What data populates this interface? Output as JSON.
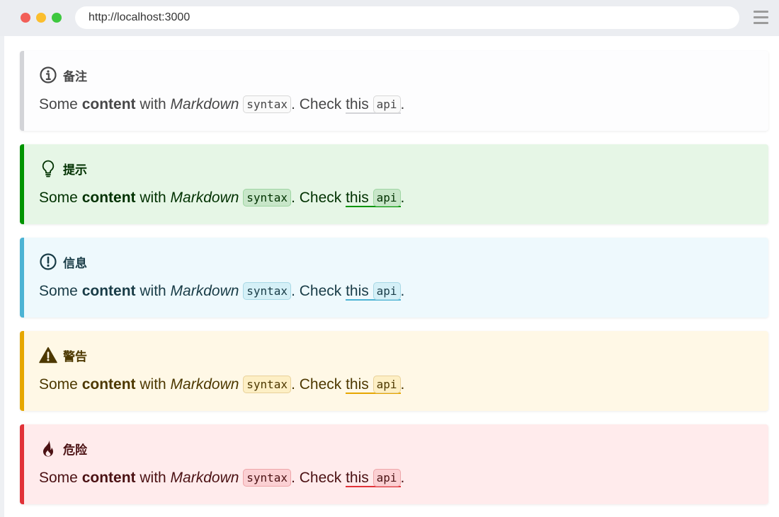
{
  "browser": {
    "url": "http://localhost:3000",
    "menu_icon": "hamburger-menu-icon"
  },
  "callouts": [
    {
      "type": "note",
      "title": "备注",
      "icon": "info-circle-icon",
      "text_some": "Some ",
      "text_bold": "content",
      "text_with": " with ",
      "text_italic": "Markdown",
      "code": "syntax",
      "text_check": ". Check ",
      "link": "this",
      "link_code": "api",
      "text_end": ".",
      "accent": "#d3d4d8"
    },
    {
      "type": "tip",
      "title": "提示",
      "icon": "lightbulb-icon",
      "text_some": "Some ",
      "text_bold": "content",
      "text_with": " with ",
      "text_italic": "Markdown",
      "code": "syntax",
      "text_check": ". Check ",
      "link": "this",
      "link_code": "api",
      "text_end": ".",
      "accent": "#009400"
    },
    {
      "type": "info",
      "title": "信息",
      "icon": "exclamation-circle-icon",
      "text_some": "Some ",
      "text_bold": "content",
      "text_with": " with ",
      "text_italic": "Markdown",
      "code": "syntax",
      "text_check": ". Check ",
      "link": "this",
      "link_code": "api",
      "text_end": ".",
      "accent": "#4cb3d4"
    },
    {
      "type": "warning",
      "title": "警告",
      "icon": "warning-triangle-icon",
      "text_some": "Some ",
      "text_bold": "content",
      "text_with": " with ",
      "text_italic": "Markdown",
      "code": "syntax",
      "text_check": ". Check ",
      "link": "this",
      "link_code": "api",
      "text_end": ".",
      "accent": "#e6a700"
    },
    {
      "type": "danger",
      "title": "危险",
      "icon": "flame-icon",
      "text_some": "Some ",
      "text_bold": "content",
      "text_with": " with ",
      "text_italic": "Markdown",
      "code": "syntax",
      "text_check": ". Check ",
      "link": "this",
      "link_code": "api",
      "text_end": ".",
      "accent": "#e13238"
    }
  ]
}
